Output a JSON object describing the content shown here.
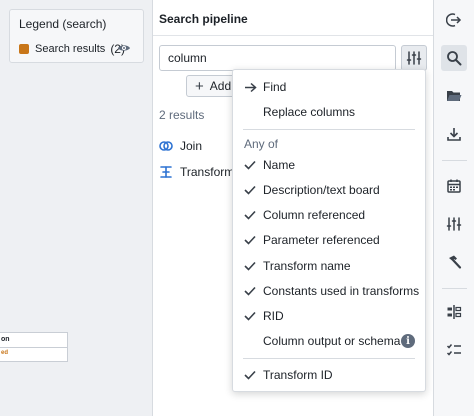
{
  "legend": {
    "title": "Legend (search)",
    "item_label": "Search results",
    "item_count": "(2)",
    "swatch_color": "#c87619",
    "eye_icon": "eye-icon"
  },
  "canvas": {
    "node_title_fragment": "on",
    "node_subtitle_fragment": "ed"
  },
  "search": {
    "title": "Search pipeline",
    "query": "column",
    "add_label": "Add",
    "results_count": "2 results",
    "results": [
      {
        "label": "Join",
        "icon": "join-icon"
      },
      {
        "label": "Transforms",
        "icon": "transforms-icon"
      }
    ]
  },
  "menu": {
    "find_label": "Find",
    "replace_label": "Replace columns",
    "heading": "Any of",
    "options": [
      {
        "label": "Name",
        "checked": true
      },
      {
        "label": "Description/text board",
        "checked": true
      },
      {
        "label": "Column referenced",
        "checked": true
      },
      {
        "label": "Parameter referenced",
        "checked": true
      },
      {
        "label": "Transform name",
        "checked": true
      },
      {
        "label": "Constants used in transforms",
        "checked": true
      },
      {
        "label": "RID",
        "checked": true
      },
      {
        "label": "Column output or schema",
        "checked": false
      },
      {
        "label": "Transform ID",
        "checked": true
      }
    ]
  },
  "toolbar": {
    "icons": [
      "exit-icon",
      "search-icon",
      "folder-icon",
      "download-icon",
      "calendar-icon",
      "sliders-icon",
      "hammer-icon",
      "split-icon",
      "checklist-icon"
    ]
  },
  "colors": {
    "accent": "#c87619",
    "check": "#394049",
    "info": "#5f6b7c"
  }
}
